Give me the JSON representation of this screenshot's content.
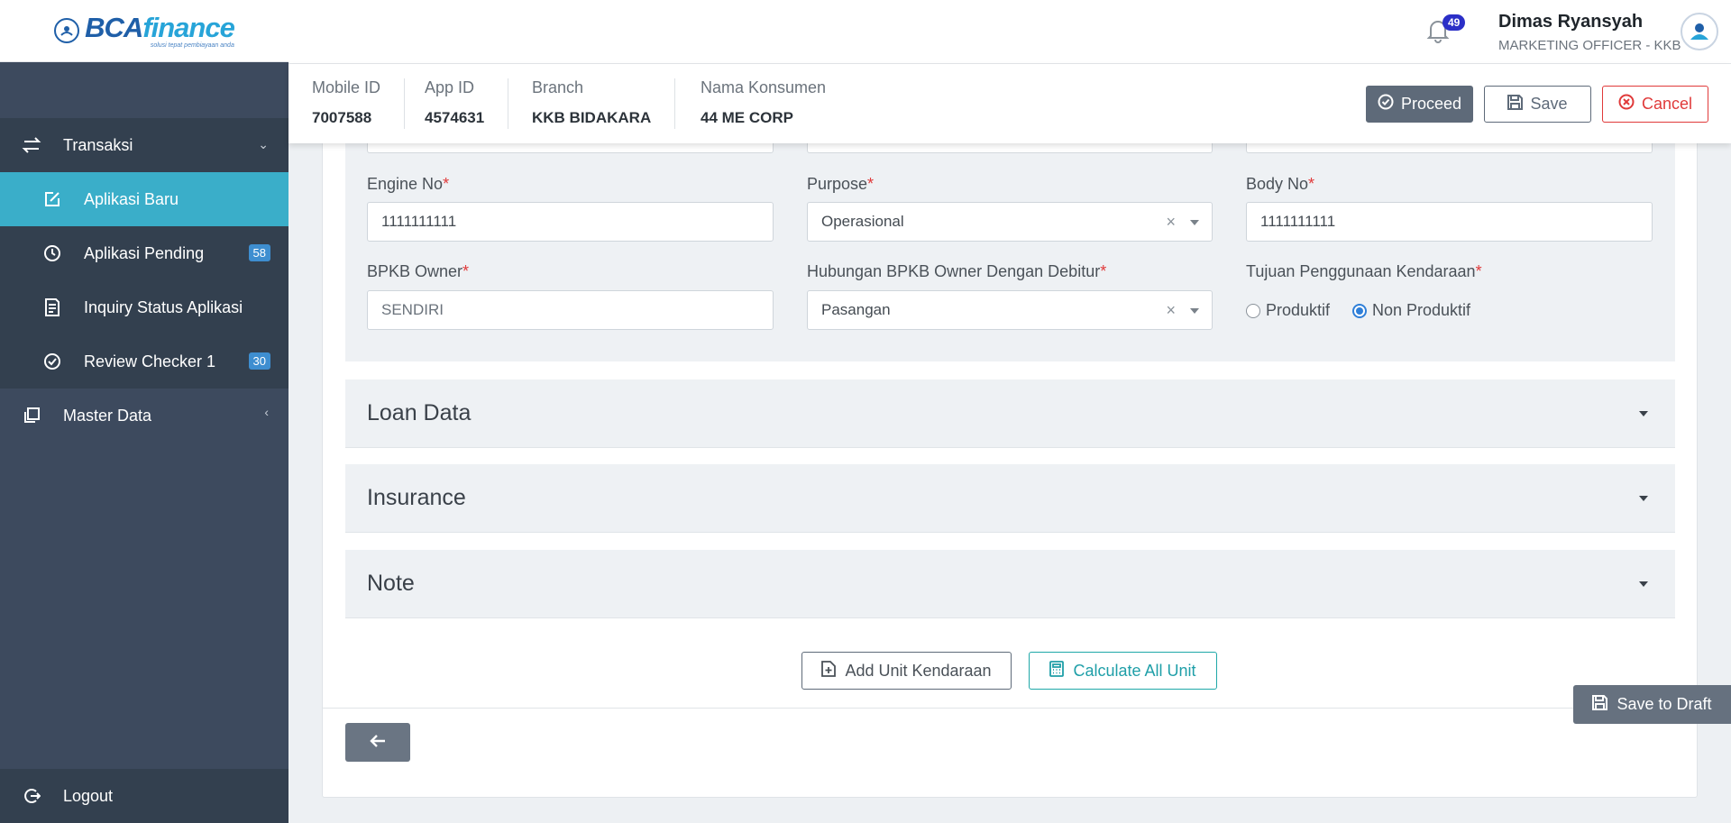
{
  "brand": {
    "logo_text_a": "BCA",
    "logo_text_b": "finance",
    "logo_tagline": "solusi tepat pembiayaan anda"
  },
  "sidebar": {
    "groups": [
      {
        "label": "Transaksi",
        "icon": "transfer-icon",
        "expanded": true
      },
      {
        "label": "Master Data",
        "icon": "copy-icon",
        "expanded": false
      }
    ],
    "items": [
      {
        "label": "Aplikasi Baru",
        "icon": "edit-icon",
        "active": true
      },
      {
        "label": "Aplikasi Pending",
        "icon": "clock-icon",
        "badge": "58"
      },
      {
        "label": "Inquiry Status Aplikasi",
        "icon": "document-icon"
      },
      {
        "label": "Review Checker 1",
        "icon": "check-circle-icon",
        "badge": "30"
      }
    ],
    "logout_label": "Logout"
  },
  "topbar": {
    "notification_count": "49",
    "user_name": "Dimas Ryansyah",
    "user_role": "MARKETING OFFICER - KKB"
  },
  "infobar": {
    "fields": [
      {
        "label": "Mobile ID",
        "value": "7007588"
      },
      {
        "label": "App ID",
        "value": "4574631"
      },
      {
        "label": "Branch",
        "value": "KKB BIDAKARA"
      },
      {
        "label": "Nama Konsumen",
        "value": "44 ME CORP"
      }
    ],
    "proceed_label": "Proceed",
    "save_label": "Save",
    "cancel_label": "Cancel"
  },
  "form": {
    "engine_no": {
      "label": "Engine No",
      "value": "1111111111"
    },
    "purpose": {
      "label": "Purpose",
      "value": "Operasional"
    },
    "body_no": {
      "label": "Body No",
      "value": "1111111111"
    },
    "bpkb_owner": {
      "label": "BPKB Owner",
      "value": "SENDIRI"
    },
    "hubungan": {
      "label": "Hubungan BPKB Owner Dengan Debitur",
      "value": "Pasangan"
    },
    "tujuan": {
      "label": "Tujuan Penggunaan Kendaraan",
      "options": [
        "Produktif",
        "Non Produktif"
      ],
      "selected": "Non Produktif"
    },
    "required_mark": "*",
    "clear_glyph": "×"
  },
  "sections": [
    {
      "title": "Loan Data"
    },
    {
      "title": "Insurance"
    },
    {
      "title": "Note"
    }
  ],
  "actions": {
    "add_unit_label": "Add Unit Kendaraan",
    "calculate_label": "Calculate All Unit",
    "save_draft_label": "Save to Draft"
  },
  "colors": {
    "sidebar_bg": "#3d4a5e",
    "active_item": "#3aaec9",
    "badge": "#3e8ed0",
    "danger": "#e03a3a",
    "teal": "#1f9fa8",
    "notification": "#2b2fc7"
  }
}
